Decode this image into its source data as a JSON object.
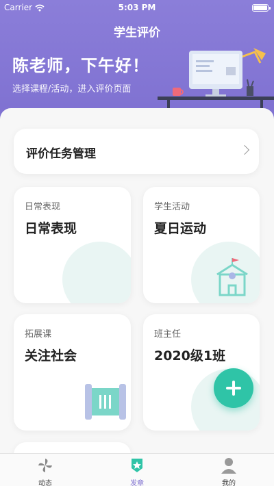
{
  "status_bar": {
    "carrier": "Carrier",
    "time": "5:03 PM"
  },
  "nav": {
    "title": "学生评价"
  },
  "header": {
    "greeting": "陈老师，下午好！",
    "subtitle": "选择课程/活动，进入评价页面"
  },
  "task_manage": {
    "label": "评价任务管理"
  },
  "tiles": [
    {
      "label": "日常表现",
      "title": "日常表现"
    },
    {
      "label": "学生活动",
      "title": "夏日运动"
    },
    {
      "label": "拓展课",
      "title": "关注社会"
    },
    {
      "label": "班主任",
      "title": "2020级1班"
    }
  ],
  "tabbar": {
    "items": [
      {
        "label": "动态",
        "icon": "pinwheel-icon"
      },
      {
        "label": "发章",
        "icon": "badge-star-icon"
      },
      {
        "label": "我的",
        "icon": "person-icon"
      }
    ]
  },
  "colors": {
    "accent": "#7d6fd0",
    "fab": "#2fc4a7",
    "tile_deco": "#e9f5f3"
  }
}
